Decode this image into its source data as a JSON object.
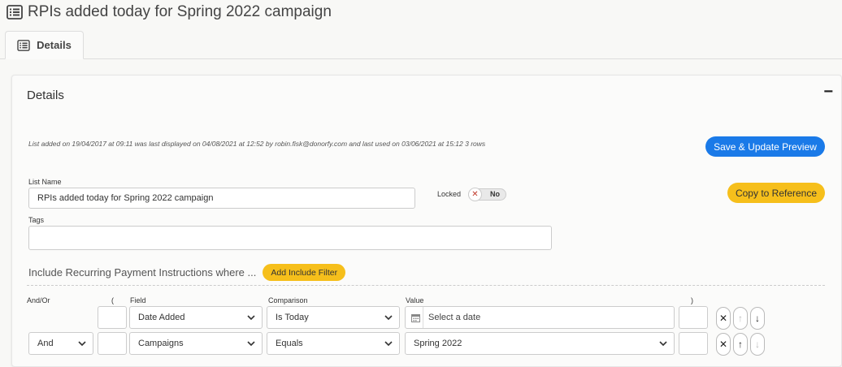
{
  "header": {
    "title": "RPIs added today for Spring 2022 campaign",
    "icon": "list-icon"
  },
  "tabs": [
    {
      "label": "Details",
      "icon": "list-icon",
      "active": true
    }
  ],
  "panel": {
    "title": "Details",
    "collapse_symbol": "−",
    "meta": "List added on 19/04/2017 at 09:11 was last displayed on 04/08/2021 at 12:52 by robin.fisk@donorfy.com and last used on 03/06/2021 at 15:12 3 rows",
    "save_button": "Save & Update Preview",
    "copy_button": "Copy to Reference",
    "list_name_label": "List Name",
    "list_name_value": "RPIs added today for Spring 2022 campaign",
    "locked_label": "Locked",
    "locked_value": "No",
    "tags_label": "Tags",
    "tags_value": "",
    "include_text": "Include Recurring Payment Instructions where ...",
    "add_filter_button": "Add Include Filter"
  },
  "filters": {
    "headers": {
      "andor": "And/Or",
      "open": "(",
      "field": "Field",
      "comparison": "Comparison",
      "value": "Value",
      "close": ")"
    },
    "rows": [
      {
        "andor": "",
        "open": "",
        "field": "Date Added",
        "comparison": "Is Today",
        "value": "",
        "value_placeholder": "Select a date",
        "close": ""
      },
      {
        "andor": "And",
        "open": "",
        "field": "Campaigns",
        "comparison": "Equals",
        "value": "Spring 2022",
        "value_placeholder": "",
        "close": ""
      }
    ]
  },
  "colors": {
    "blue": "#1a7ae8",
    "yellow": "#f6bf1b"
  }
}
